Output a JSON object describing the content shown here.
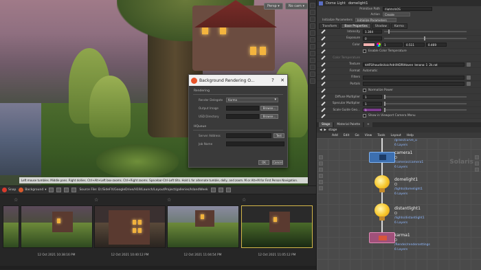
{
  "viewport": {
    "top_buttons": [
      "Persp ▾",
      "No cam ▾"
    ],
    "status_hint": "Left mouse tumbles. Middle pans. Right dollies. Ctrl+Alt+Left box-zooms. Ctrl+Right zooms. Spacebar-Ctrl-Left tilts. Hold L for alternate tumble, dolly, and zoom.    M or Alt+M for First Person Navigation."
  },
  "dialog": {
    "title": "Background Rendering O...",
    "help": "?",
    "close": "✕",
    "section_rendering": "Rendering",
    "render_delegate_label": "Render Delegate",
    "render_delegate_value": "Karma",
    "output_image_label": "Output Image",
    "usd_directory_label": "USD Directory",
    "browse": "Browse...",
    "section_hqueue": "HQueue",
    "server_address_label": "Server Address",
    "test": "Test",
    "job_name_label": "Job Name",
    "ok": "OK",
    "cancel": "Cancel"
  },
  "gallery_bar": {
    "snap": "Snap",
    "background": "Background",
    "source": "Source File: D:/SideFX/GoogleDrive/H19/Launch/LayoutProject/galleries/IslandWeek"
  },
  "gallery": {
    "dates": [
      "12 Oct 2021 10:38:16 PM",
      "12 Oct 2021 10:40:12 PM",
      "12 Oct 2021 11:04:54 PM",
      "12 Oct 2021 11:05:12 PM"
    ]
  },
  "params": {
    "node_type": "Dome Light",
    "node_name": "domelight1",
    "primitive_path_label": "Primitive Path",
    "primitive_path": "/lights/$OS",
    "action_label": "Action",
    "action": "Create",
    "init_params_label": "Initialize Parameters",
    "init_params": "Initialize Parameters",
    "tabs": [
      "Transform",
      "Base Properties",
      "Shadow",
      "Karma"
    ],
    "rows": {
      "intensity_label": "Intensity",
      "intensity": "1.304",
      "exposure_label": "Exposure",
      "exposure": "0",
      "color_label": "Color",
      "color_a": "1",
      "color_b": "0.511",
      "color_c": "0.469",
      "enable_ct": "Enable Color Temperature",
      "color_temp_label": "Color Temperature",
      "texture_label": "Texture",
      "texture": "$HFS/houdini/pic/hdri/HDRIHaven_lenong_1_2k.rat",
      "format_label": "Format",
      "format": "Automatic",
      "filters_label": "Filters",
      "portals_label": "Portals",
      "normalize": "Normalize Power",
      "diffuse_label": "Diffuse Multiplier",
      "diffuse": "1",
      "specular_label": "Specular Multiplier",
      "specular": "1",
      "scale_guide_label": "Scale Guide Geo...",
      "scale_guide": "1",
      "show_in_viewport": "Show in Viewport Camera Menu"
    },
    "colors": {
      "swatch": "#f2b2b0",
      "scale_swatch": "#7b3c8c"
    }
  },
  "network": {
    "tabs": [
      "Stage",
      "Material Palette",
      "+"
    ],
    "path": "stage",
    "menu": [
      "Add",
      "Edit",
      "Go",
      "View",
      "Tools",
      "Layout",
      "Help"
    ],
    "watermark": "Solaris",
    "top_path": "/grass/curve_u",
    "top_count": "6 Layers",
    "nodes": [
      {
        "name": "camera1",
        "flag": "O",
        "path": "/cameras/camera1",
        "count": "6 Layers"
      },
      {
        "name": "domelight1",
        "flag": "O",
        "path": "/lights/domelight1",
        "count": "6 Layers"
      },
      {
        "name": "distantlight1",
        "flag": "O",
        "path": "/lights/distantlight1",
        "count": "6 Layers"
      },
      {
        "name": "karma1",
        "flag": "O",
        "path": "/Render/rendersettings",
        "count": "6 Layers"
      }
    ]
  }
}
